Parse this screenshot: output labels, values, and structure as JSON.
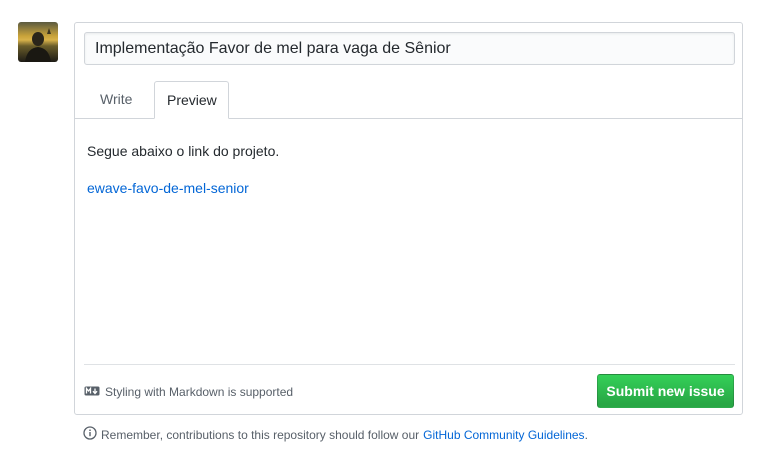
{
  "issue_form": {
    "title_value": "Implementação Favor de mel para vaga de Sênior",
    "tabs": [
      {
        "label": "Write",
        "active": false
      },
      {
        "label": "Preview",
        "active": true
      }
    ],
    "preview": {
      "paragraph": "Segue abaixo o link do projeto.",
      "link_text": "ewave-favo-de-mel-senior"
    },
    "markdown_note": "Styling with Markdown is supported",
    "submit_label": "Submit new issue"
  },
  "footer": {
    "guidelines_prefix": "Remember, contributions to this repository should follow our",
    "guidelines_link": "GitHub Community Guidelines",
    "guidelines_suffix": "."
  },
  "colors": {
    "link": "#0366d6",
    "submit_green": "#28a745",
    "border": "#d1d5da"
  },
  "icons": [
    "markdown-icon",
    "info-icon"
  ]
}
